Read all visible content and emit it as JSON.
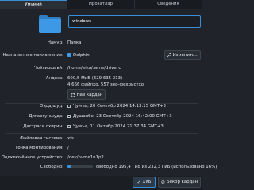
{
  "tabs": [
    "Умумий",
    "Ирозатлар",
    "Сведения"
  ],
  "name_value": "windows",
  "fields": {
    "type_label": "Намуд:",
    "type_value": "Папка",
    "app_label": "Назначенное приложение:",
    "app_value": "Dolphin",
    "change_label": "Изменить...",
    "location_label": "Ҷойгиршавӣ:",
    "location_value": "/home/eika/.wine/drive_c",
    "size_label": "Андоза:",
    "size_line1": "600,5 МиБ (629 635 213)",
    "size_line2": "4 666 файлҳо, 557 зер-феҳристҳо",
    "new_tab_label": "Нав кардан",
    "created_label": "Эҷод шуд:",
    "created_value": "Ҷумъа, 20 Сентябр 2024 14:13:15 GMT+3",
    "modified_label": "Дигаргуншуда:",
    "modified_value": "Душанбе, 23 Сентябр 2024 16:42:00 GMT+3",
    "accessed_label": "Дастраси охирин:",
    "accessed_value": "Ҷумъа, 11 Октябр 2024 21:37:34 GMT+3",
    "fs_label": "Файловая система:",
    "fs_value": "xfs",
    "mount_label": "Точка монтирования:",
    "mount_value": "/",
    "device_label": "Подключённое устройство:",
    "device_value": "/dev/nvme1n1p2",
    "free_label": "Свободно:",
    "free_value": "свободно 195,4 ГиБ из 232,3 ГиБ (использовано 16%)",
    "used_fraction": 0.16
  },
  "buttons": {
    "ok_label": "ХУБ",
    "cancel_label": "Бекор кардан"
  },
  "colors": {
    "accent": "#3a90d8",
    "folder": "#3a8fd6"
  }
}
